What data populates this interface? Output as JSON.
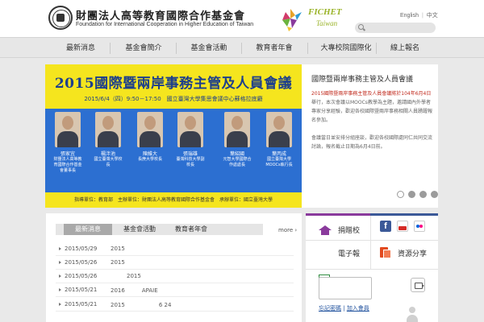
{
  "header": {
    "org_name_cn": "財團法人高等教育國際合作基金會",
    "org_name_en": "Foundation for International Cooperation in Higher Education of Taiwan",
    "brand_text": "FICHET",
    "brand_sub": "Taiwan",
    "lang_en": "English",
    "lang_zh": "中文",
    "lang_sep": "|"
  },
  "nav": {
    "items": [
      "最新消息",
      "基金會簡介",
      "基金會活動",
      "教育者年會",
      "大專校院國際化",
      "線上報名"
    ]
  },
  "banner": {
    "title": "2015國際暨兩岸事務主管及人員會議",
    "info": "2015/6/4（四）9:50－17:50　國立臺灣大學集思會議中心蘇格拉底廳",
    "speakers": [
      {
        "name": "張家宜",
        "title": "財團法人高等教育國際合作基金會董事長"
      },
      {
        "name": "楊泮池",
        "title": "國立臺灣大學校長"
      },
      {
        "name": "陳維大",
        "title": "長庚大學校長"
      },
      {
        "name": "張瑞雄",
        "title": "臺灣科技大學副校長"
      },
      {
        "name": "葉紹國",
        "title": "元智大學國際合作處處長"
      },
      {
        "name": "葉丙成",
        "title": "國立臺灣大學MOOCs執行長"
      }
    ],
    "footer": "指導單位：教育部　主辦單位：財團法人高等教育國際合作基金會　承辦單位：國立臺灣大學",
    "side_title": "國際暨兩岸事務主管及人員會議",
    "side_highlight": "2015國際暨兩岸事務主管及人員會議將於104年6月4日",
    "side_body_1": "舉行，本次會議以MOOCs教學為主題，邀請國內外學者專家分享經驗，歡迎各校國際暨兩岸事務相關人員踴躍報名參加。",
    "side_body_2": "會議當日並安排分組座談，歡迎各校國際處同仁共同交流討論，報名截止日期為6月4日前。"
  },
  "news": {
    "tabs": [
      "最新消息",
      "基金會活動",
      "教育者年會"
    ],
    "more_label": "more",
    "rows": [
      {
        "date": "2015/05/29",
        "text": "2015"
      },
      {
        "date": "2015/05/26",
        "text": "2015"
      },
      {
        "date": "2015/05/26",
        "text": "2015"
      },
      {
        "date": "2015/05/21",
        "text": "2016　　　APAIE"
      },
      {
        "date": "2015/05/21",
        "text": "2015　　　　　　6 24"
      }
    ]
  },
  "quick": {
    "partner_label": "捐贈校",
    "enews_label": "電子報",
    "share_label": "資源分享",
    "link_1": "忘記密碼",
    "link_2": "加入會員"
  },
  "colors": {
    "poster_yellow": "#f5e51e",
    "poster_blue": "#2c6fd1",
    "title_blue": "#1d3f8c",
    "highlight_red": "#c0281b",
    "brand_green": "#9ab328"
  }
}
